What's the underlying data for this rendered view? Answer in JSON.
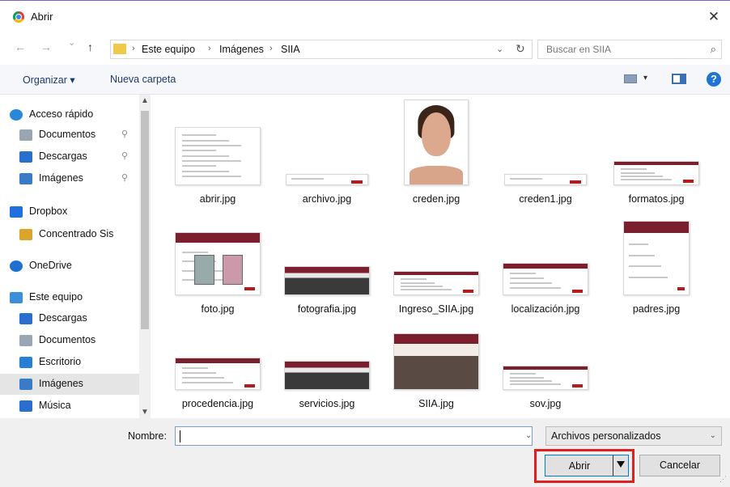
{
  "window": {
    "title": "Abrir",
    "close_glyph": "✕"
  },
  "nav": {
    "back": "←",
    "forward": "→",
    "recent": "⌄",
    "up": "↑",
    "breadcrumbs": [
      "Este equipo",
      "Imágenes",
      "SIIA"
    ],
    "separator": "›",
    "dropdown": "⌄",
    "refresh": "↻",
    "search_placeholder": "Buscar en SIIA",
    "search_glyph": "⌕"
  },
  "toolbar": {
    "organize": "Organizar ▾",
    "new_folder": "Nueva carpeta",
    "view_dropdown": "▾",
    "help": "?"
  },
  "sidebar": {
    "items": [
      {
        "label": "Acceso rápido",
        "icon": "star-icon",
        "pinned": false
      },
      {
        "label": "Documentos",
        "icon": "document-icon",
        "pinned": true
      },
      {
        "label": "Descargas",
        "icon": "download-icon",
        "pinned": true
      },
      {
        "label": "Imágenes",
        "icon": "pictures-icon",
        "pinned": true
      },
      {
        "label": "Dropbox",
        "icon": "dropbox-icon",
        "pinned": false
      },
      {
        "label": "Concentrado Sis",
        "icon": "shared-folder-icon",
        "pinned": false
      },
      {
        "label": "OneDrive",
        "icon": "cloud-icon",
        "pinned": false
      },
      {
        "label": "Este equipo",
        "icon": "computer-icon",
        "pinned": false
      },
      {
        "label": "Descargas",
        "icon": "download-icon",
        "pinned": false
      },
      {
        "label": "Documentos",
        "icon": "document-icon",
        "pinned": false
      },
      {
        "label": "Escritorio",
        "icon": "desktop-icon",
        "pinned": false
      },
      {
        "label": "Imágenes",
        "icon": "pictures-icon",
        "pinned": false,
        "selected": true
      },
      {
        "label": "Música",
        "icon": "music-icon",
        "pinned": false
      }
    ],
    "pin_glyph": "⚲",
    "scroll_up": "▲",
    "scroll_down": "▼"
  },
  "files": [
    {
      "name": "abrir.jpg",
      "kind": "screenshot"
    },
    {
      "name": "archivo.jpg",
      "kind": "dialog"
    },
    {
      "name": "creden.jpg",
      "kind": "portrait"
    },
    {
      "name": "creden1.jpg",
      "kind": "dialog"
    },
    {
      "name": "formatos.jpg",
      "kind": "webpage"
    },
    {
      "name": "foto.jpg",
      "kind": "webpage-photo"
    },
    {
      "name": "fotografia.jpg",
      "kind": "webpage-dark"
    },
    {
      "name": "Ingreso_SIIA.jpg",
      "kind": "webpage"
    },
    {
      "name": "localización.jpg",
      "kind": "form"
    },
    {
      "name": "padres.jpg",
      "kind": "form-tall"
    },
    {
      "name": "procedencia.jpg",
      "kind": "form"
    },
    {
      "name": "servicios.jpg",
      "kind": "webpage-dark"
    },
    {
      "name": "SIIA.jpg",
      "kind": "group-photo"
    },
    {
      "name": "sov.jpg",
      "kind": "webpage"
    }
  ],
  "bottom": {
    "name_label": "Nombre:",
    "name_value": "",
    "filter": "Archivos personalizados",
    "dropdown": "⌄",
    "open_button": "Abrir",
    "cancel_button": "Cancelar"
  },
  "colors": {
    "accent": "#0078d7",
    "highlight": "#e02020",
    "brand": "#7b1f2e"
  }
}
